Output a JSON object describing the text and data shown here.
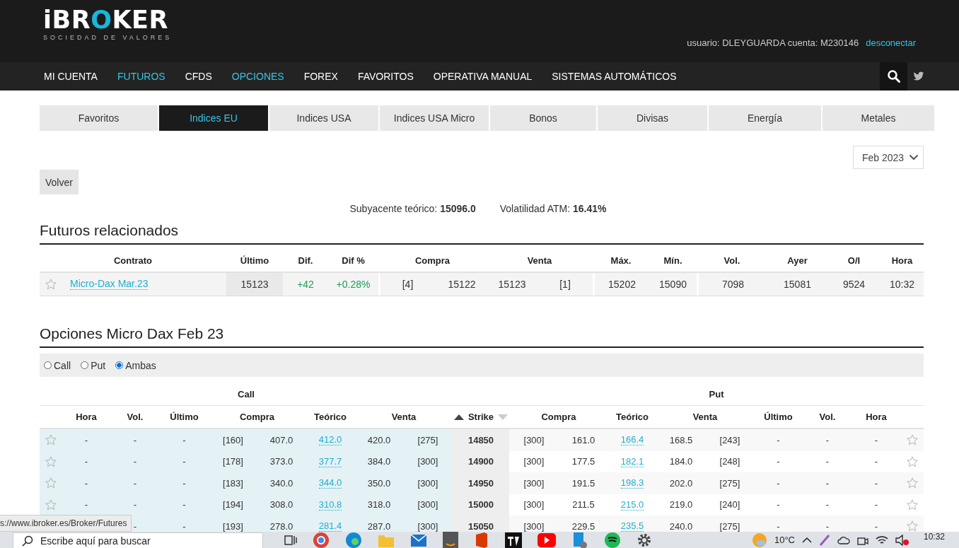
{
  "logo": {
    "parts": [
      {
        "text": "iBR",
        "accent": false
      },
      {
        "text": "O",
        "accent": true
      },
      {
        "text": "KER",
        "accent": false
      }
    ],
    "tagline": "SOCIEDAD DE VALORES"
  },
  "user_info": {
    "text": "usuario: DLEYGUARDA cuenta: M230146",
    "logout": "desconectar"
  },
  "nav": [
    {
      "label": "MI CUENTA",
      "highlighted": false
    },
    {
      "label": "FUTUROS",
      "highlighted": true
    },
    {
      "label": "CFDS",
      "highlighted": false
    },
    {
      "label": "OPCIONES",
      "highlighted": true
    },
    {
      "label": "FOREX",
      "highlighted": false
    },
    {
      "label": "FAVORITOS",
      "highlighted": false
    },
    {
      "label": "OPERATIVA MANUAL",
      "highlighted": false
    },
    {
      "label": "SISTEMAS AUTOMÁTICOS",
      "highlighted": false
    }
  ],
  "tabs": [
    {
      "label": "Favoritos",
      "selected": false
    },
    {
      "label": "Indices EU",
      "selected": true
    },
    {
      "label": "Indices USA",
      "selected": false
    },
    {
      "label": "Indices USA Micro",
      "selected": false
    },
    {
      "label": "Bonos",
      "selected": false
    },
    {
      "label": "Divisas",
      "selected": false
    },
    {
      "label": "Energía",
      "selected": false
    },
    {
      "label": "Metales",
      "selected": false
    }
  ],
  "month_select": {
    "value": "Feb 2023"
  },
  "back_button": "Volver",
  "summary": [
    "Subyacente teórico: **15096.0**",
    "Volatilidad ATM: **16.41%**"
  ],
  "futures": {
    "title": "Futuros relacionados",
    "columns": [
      "Contrato",
      "Último",
      "Dif.",
      "Dif %",
      "Compra",
      "Venta",
      "Máx.",
      "Mín.",
      "Vol.",
      "Ayer",
      "O/I",
      "Hora"
    ],
    "rows": [
      {
        "favorite": false,
        "cells": [
          "Micro-Dax Mar.23",
          "15123",
          "+42",
          "+0.28%",
          {
            "size": "[4]",
            "price": "15122"
          },
          {
            "price": "15123",
            "size": "[1]"
          },
          "15202",
          "15090",
          "7098",
          "15081",
          "9524",
          "10:32"
        ]
      }
    ]
  },
  "options": {
    "title": "Opciones Micro Dax Feb 23",
    "filters": [
      {
        "label": "Call",
        "selected": false
      },
      {
        "label": "Put",
        "selected": false
      },
      {
        "label": "Ambas",
        "selected": true
      }
    ],
    "groups": [
      "Call",
      "Put"
    ],
    "call_columns": [
      "Hora",
      "Vol.",
      "Último",
      "Compra",
      "Teórico",
      "Venta"
    ],
    "strike_column": "Strike",
    "put_columns": [
      "Compra",
      "Teórico",
      "Venta",
      "Último",
      "Vol.",
      "Hora"
    ],
    "rows": [
      {
        "call_favorite": false,
        "call": [
          "-",
          "-",
          "-",
          "[160]",
          "407.0",
          "412.0",
          "420.0",
          "[275]"
        ],
        "strike": "14850",
        "put": [
          "[300]",
          "161.0",
          "166.4",
          "168.5",
          "[243]",
          "-",
          "-",
          "-"
        ],
        "put_favorite": false
      },
      {
        "call_favorite": false,
        "call": [
          "-",
          "-",
          "-",
          "[178]",
          "373.0",
          "377.7",
          "384.0",
          "[300]"
        ],
        "strike": "14900",
        "put": [
          "[300]",
          "177.5",
          "182.1",
          "184.0",
          "[248]",
          "-",
          "-",
          "-"
        ],
        "put_favorite": false
      },
      {
        "call_favorite": false,
        "call": [
          "-",
          "-",
          "-",
          "[183]",
          "340.0",
          "344.0",
          "350.0",
          "[300]"
        ],
        "strike": "14950",
        "put": [
          "[300]",
          "191.5",
          "198.3",
          "202.0",
          "[275]",
          "-",
          "-",
          "-"
        ],
        "put_favorite": false
      },
      {
        "call_favorite": false,
        "call": [
          "-",
          "-",
          "-",
          "[194]",
          "308.0",
          "310.8",
          "318.0",
          "[300]"
        ],
        "strike": "15000",
        "put": [
          "[300]",
          "211.5",
          "215.0",
          "219.0",
          "[240]",
          "-",
          "-",
          "-"
        ],
        "put_favorite": false
      },
      {
        "call": [
          "-",
          "-",
          "[193]",
          "278.0",
          "281.4",
          "287.0",
          "[300]"
        ],
        "strike": "15050",
        "put": [
          "[300]",
          "229.5",
          "235.5",
          "240.0",
          "[275]",
          "-",
          "-",
          "-"
        ],
        "put_favorite": false
      }
    ]
  },
  "status_url": "s://www.ibroker.es/Broker/Futures",
  "taskbar": {
    "search_placeholder": "Escribe aquí para buscar",
    "temperature": "10°C",
    "time": "10:32"
  }
}
